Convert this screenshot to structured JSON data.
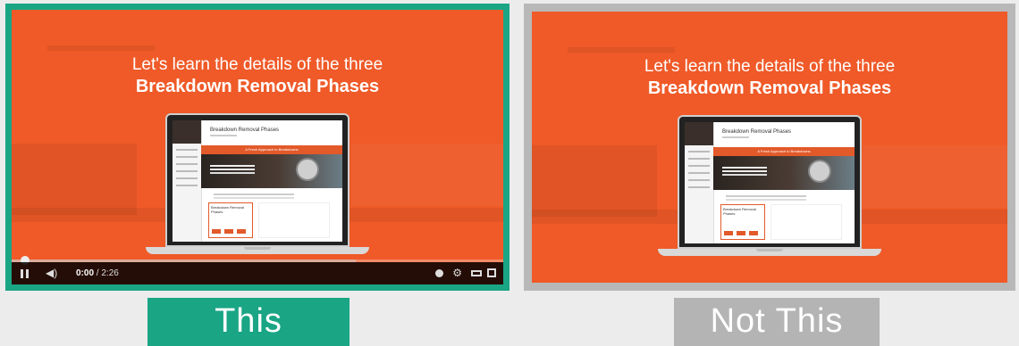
{
  "left_panel": {
    "video": {
      "headline_line1": "Let's learn the details of the three",
      "headline_line2": "Breakdown Removal Phases",
      "screen_title": "Breakdown Removal Phases",
      "screen_banner": "A Fresh Approach to Breakdowns",
      "screen_card_title": "Breakdown Removal Phases"
    },
    "player": {
      "current_time": "0:00",
      "duration": " / 2:26",
      "progress_fraction": 0.0,
      "buffered_fraction": 0.7
    },
    "caption": "This",
    "border_color": "#1aa585"
  },
  "right_panel": {
    "video": {
      "headline_line1": "Let's learn the details of the three",
      "headline_line2": "Breakdown Removal Phases",
      "screen_title": "Breakdown Removal Phases",
      "screen_banner": "A Fresh Approach to Breakdowns",
      "screen_card_title": "Breakdown Removal Phases"
    },
    "caption": "Not This",
    "border_color": "#b8b8b8"
  },
  "colors": {
    "video_bg": "#ef5a28",
    "good": "#1aa585",
    "bad": "#b4b4b4"
  }
}
